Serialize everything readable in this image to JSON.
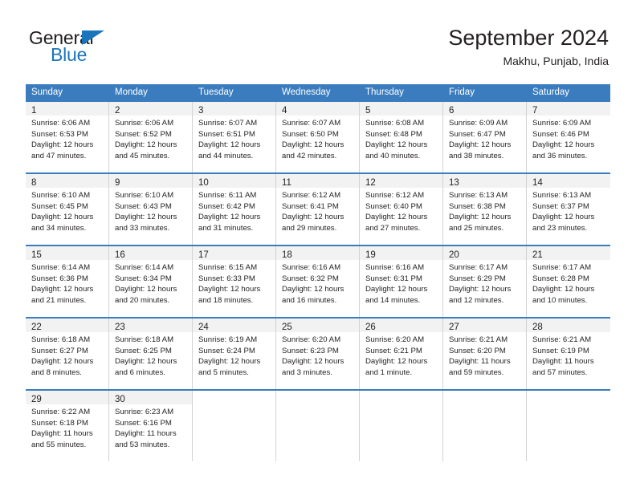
{
  "brand": {
    "name_top": "General",
    "name_bottom": "Blue",
    "accent_color": "#1b75bb"
  },
  "header": {
    "title": "September 2024",
    "subtitle": "Makhu, Punjab, India"
  },
  "theme": {
    "header_bg": "#3a7cbe",
    "header_text": "#ffffff",
    "daynum_bg": "#f2f2f2",
    "cell_border": "#d3d3d3",
    "text": "#231f20"
  },
  "weekday_headers": [
    "Sunday",
    "Monday",
    "Tuesday",
    "Wednesday",
    "Thursday",
    "Friday",
    "Saturday"
  ],
  "weeks": [
    [
      {
        "day": "1",
        "sunrise": "Sunrise: 6:06 AM",
        "sunset": "Sunset: 6:53 PM",
        "daylight_1": "Daylight: 12 hours",
        "daylight_2": "and 47 minutes."
      },
      {
        "day": "2",
        "sunrise": "Sunrise: 6:06 AM",
        "sunset": "Sunset: 6:52 PM",
        "daylight_1": "Daylight: 12 hours",
        "daylight_2": "and 45 minutes."
      },
      {
        "day": "3",
        "sunrise": "Sunrise: 6:07 AM",
        "sunset": "Sunset: 6:51 PM",
        "daylight_1": "Daylight: 12 hours",
        "daylight_2": "and 44 minutes."
      },
      {
        "day": "4",
        "sunrise": "Sunrise: 6:07 AM",
        "sunset": "Sunset: 6:50 PM",
        "daylight_1": "Daylight: 12 hours",
        "daylight_2": "and 42 minutes."
      },
      {
        "day": "5",
        "sunrise": "Sunrise: 6:08 AM",
        "sunset": "Sunset: 6:48 PM",
        "daylight_1": "Daylight: 12 hours",
        "daylight_2": "and 40 minutes."
      },
      {
        "day": "6",
        "sunrise": "Sunrise: 6:09 AM",
        "sunset": "Sunset: 6:47 PM",
        "daylight_1": "Daylight: 12 hours",
        "daylight_2": "and 38 minutes."
      },
      {
        "day": "7",
        "sunrise": "Sunrise: 6:09 AM",
        "sunset": "Sunset: 6:46 PM",
        "daylight_1": "Daylight: 12 hours",
        "daylight_2": "and 36 minutes."
      }
    ],
    [
      {
        "day": "8",
        "sunrise": "Sunrise: 6:10 AM",
        "sunset": "Sunset: 6:45 PM",
        "daylight_1": "Daylight: 12 hours",
        "daylight_2": "and 34 minutes."
      },
      {
        "day": "9",
        "sunrise": "Sunrise: 6:10 AM",
        "sunset": "Sunset: 6:43 PM",
        "daylight_1": "Daylight: 12 hours",
        "daylight_2": "and 33 minutes."
      },
      {
        "day": "10",
        "sunrise": "Sunrise: 6:11 AM",
        "sunset": "Sunset: 6:42 PM",
        "daylight_1": "Daylight: 12 hours",
        "daylight_2": "and 31 minutes."
      },
      {
        "day": "11",
        "sunrise": "Sunrise: 6:12 AM",
        "sunset": "Sunset: 6:41 PM",
        "daylight_1": "Daylight: 12 hours",
        "daylight_2": "and 29 minutes."
      },
      {
        "day": "12",
        "sunrise": "Sunrise: 6:12 AM",
        "sunset": "Sunset: 6:40 PM",
        "daylight_1": "Daylight: 12 hours",
        "daylight_2": "and 27 minutes."
      },
      {
        "day": "13",
        "sunrise": "Sunrise: 6:13 AM",
        "sunset": "Sunset: 6:38 PM",
        "daylight_1": "Daylight: 12 hours",
        "daylight_2": "and 25 minutes."
      },
      {
        "day": "14",
        "sunrise": "Sunrise: 6:13 AM",
        "sunset": "Sunset: 6:37 PM",
        "daylight_1": "Daylight: 12 hours",
        "daylight_2": "and 23 minutes."
      }
    ],
    [
      {
        "day": "15",
        "sunrise": "Sunrise: 6:14 AM",
        "sunset": "Sunset: 6:36 PM",
        "daylight_1": "Daylight: 12 hours",
        "daylight_2": "and 21 minutes."
      },
      {
        "day": "16",
        "sunrise": "Sunrise: 6:14 AM",
        "sunset": "Sunset: 6:34 PM",
        "daylight_1": "Daylight: 12 hours",
        "daylight_2": "and 20 minutes."
      },
      {
        "day": "17",
        "sunrise": "Sunrise: 6:15 AM",
        "sunset": "Sunset: 6:33 PM",
        "daylight_1": "Daylight: 12 hours",
        "daylight_2": "and 18 minutes."
      },
      {
        "day": "18",
        "sunrise": "Sunrise: 6:16 AM",
        "sunset": "Sunset: 6:32 PM",
        "daylight_1": "Daylight: 12 hours",
        "daylight_2": "and 16 minutes."
      },
      {
        "day": "19",
        "sunrise": "Sunrise: 6:16 AM",
        "sunset": "Sunset: 6:31 PM",
        "daylight_1": "Daylight: 12 hours",
        "daylight_2": "and 14 minutes."
      },
      {
        "day": "20",
        "sunrise": "Sunrise: 6:17 AM",
        "sunset": "Sunset: 6:29 PM",
        "daylight_1": "Daylight: 12 hours",
        "daylight_2": "and 12 minutes."
      },
      {
        "day": "21",
        "sunrise": "Sunrise: 6:17 AM",
        "sunset": "Sunset: 6:28 PM",
        "daylight_1": "Daylight: 12 hours",
        "daylight_2": "and 10 minutes."
      }
    ],
    [
      {
        "day": "22",
        "sunrise": "Sunrise: 6:18 AM",
        "sunset": "Sunset: 6:27 PM",
        "daylight_1": "Daylight: 12 hours",
        "daylight_2": "and 8 minutes."
      },
      {
        "day": "23",
        "sunrise": "Sunrise: 6:18 AM",
        "sunset": "Sunset: 6:25 PM",
        "daylight_1": "Daylight: 12 hours",
        "daylight_2": "and 6 minutes."
      },
      {
        "day": "24",
        "sunrise": "Sunrise: 6:19 AM",
        "sunset": "Sunset: 6:24 PM",
        "daylight_1": "Daylight: 12 hours",
        "daylight_2": "and 5 minutes."
      },
      {
        "day": "25",
        "sunrise": "Sunrise: 6:20 AM",
        "sunset": "Sunset: 6:23 PM",
        "daylight_1": "Daylight: 12 hours",
        "daylight_2": "and 3 minutes."
      },
      {
        "day": "26",
        "sunrise": "Sunrise: 6:20 AM",
        "sunset": "Sunset: 6:21 PM",
        "daylight_1": "Daylight: 12 hours",
        "daylight_2": "and 1 minute."
      },
      {
        "day": "27",
        "sunrise": "Sunrise: 6:21 AM",
        "sunset": "Sunset: 6:20 PM",
        "daylight_1": "Daylight: 11 hours",
        "daylight_2": "and 59 minutes."
      },
      {
        "day": "28",
        "sunrise": "Sunrise: 6:21 AM",
        "sunset": "Sunset: 6:19 PM",
        "daylight_1": "Daylight: 11 hours",
        "daylight_2": "and 57 minutes."
      }
    ],
    [
      {
        "day": "29",
        "sunrise": "Sunrise: 6:22 AM",
        "sunset": "Sunset: 6:18 PM",
        "daylight_1": "Daylight: 11 hours",
        "daylight_2": "and 55 minutes."
      },
      {
        "day": "30",
        "sunrise": "Sunrise: 6:23 AM",
        "sunset": "Sunset: 6:16 PM",
        "daylight_1": "Daylight: 11 hours",
        "daylight_2": "and 53 minutes."
      },
      {
        "day": "",
        "sunrise": "",
        "sunset": "",
        "daylight_1": "",
        "daylight_2": ""
      },
      {
        "day": "",
        "sunrise": "",
        "sunset": "",
        "daylight_1": "",
        "daylight_2": ""
      },
      {
        "day": "",
        "sunrise": "",
        "sunset": "",
        "daylight_1": "",
        "daylight_2": ""
      },
      {
        "day": "",
        "sunrise": "",
        "sunset": "",
        "daylight_1": "",
        "daylight_2": ""
      },
      {
        "day": "",
        "sunrise": "",
        "sunset": "",
        "daylight_1": "",
        "daylight_2": ""
      }
    ]
  ]
}
